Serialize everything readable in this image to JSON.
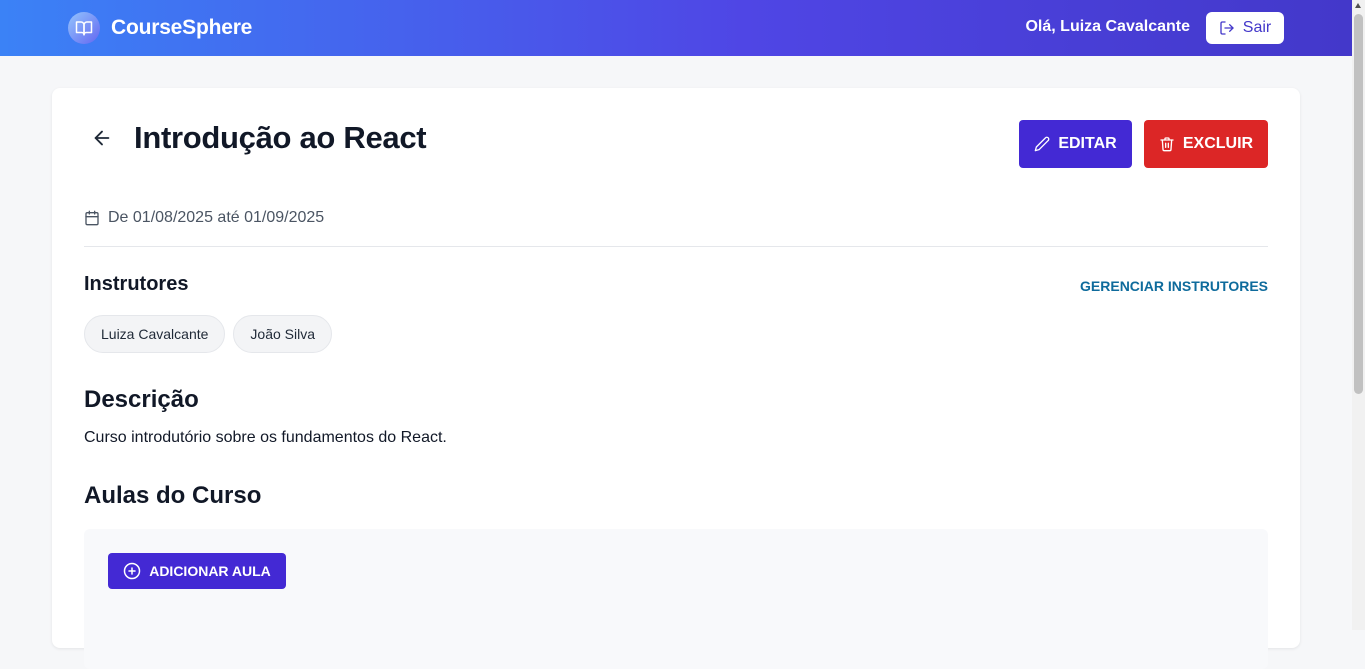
{
  "header": {
    "brand_name": "CourseSphere",
    "greeting": "Olá, Luiza Cavalcante",
    "logout_label": "Sair"
  },
  "course": {
    "title": "Introdução ao React",
    "edit_label": "EDITAR",
    "delete_label": "EXCLUIR",
    "dates": "De 01/08/2025 até 01/09/2025"
  },
  "instructors": {
    "heading": "Instrutores",
    "manage_label": "GERENCIAR INSTRUTORES",
    "items": [
      {
        "name": "Luiza Cavalcante"
      },
      {
        "name": "João Silva"
      }
    ]
  },
  "description": {
    "heading": "Descrição",
    "text": "Curso introdutório sobre os fundamentos do React."
  },
  "lessons": {
    "heading": "Aulas do Curso",
    "add_label": "ADICIONAR AULA"
  },
  "colors": {
    "primary": "#4329d4",
    "danger": "#dc2626",
    "link": "#0e6b9c",
    "header_gradient_start": "#3b82f6",
    "header_gradient_end": "#4338ca"
  },
  "icons": {
    "brand": "book-open-icon",
    "logout": "logout-icon",
    "back": "arrow-left-icon",
    "edit": "pencil-icon",
    "delete": "trash-icon",
    "dates": "calendar-icon",
    "add": "plus-circle-icon"
  }
}
